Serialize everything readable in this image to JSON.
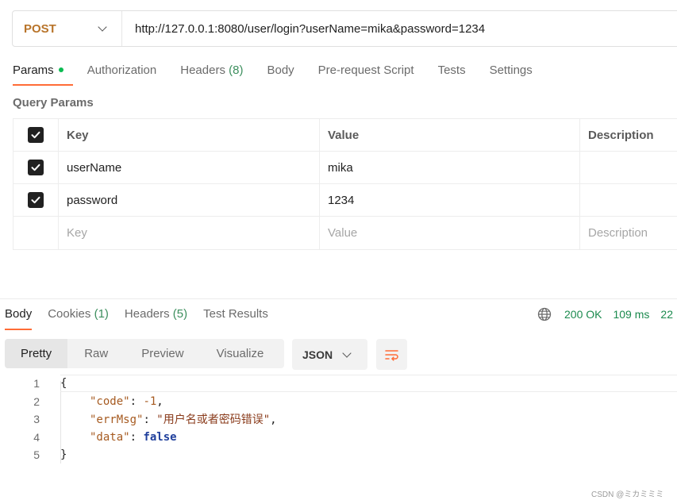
{
  "request": {
    "method": "POST",
    "url": "http://127.0.0.1:8080/user/login?userName=mika&password=1234",
    "tabs": [
      {
        "label": "Params",
        "active": true
      },
      {
        "label": "Authorization"
      },
      {
        "label": "Headers",
        "count": "(8)"
      },
      {
        "label": "Body"
      },
      {
        "label": "Pre-request Script"
      },
      {
        "label": "Tests"
      },
      {
        "label": "Settings"
      }
    ]
  },
  "query_params": {
    "title": "Query Params",
    "headers": {
      "key": "Key",
      "value": "Value",
      "description": "Description"
    },
    "rows": [
      {
        "checked": true,
        "key": "userName",
        "value": "mika",
        "description": ""
      },
      {
        "checked": true,
        "key": "password",
        "value": "1234",
        "description": ""
      }
    ],
    "placeholders": {
      "key": "Key",
      "value": "Value",
      "description": "Description"
    }
  },
  "response": {
    "tabs": [
      {
        "label": "Body",
        "active": true
      },
      {
        "label": "Cookies",
        "count": "(1)"
      },
      {
        "label": "Headers",
        "count": "(5)"
      },
      {
        "label": "Test Results"
      }
    ],
    "status": "200 OK",
    "time": "109 ms",
    "size": "22",
    "views": [
      "Pretty",
      "Raw",
      "Preview",
      "Visualize"
    ],
    "format": "JSON",
    "code_lines": [
      {
        "n": "1",
        "text": "{"
      },
      {
        "n": "2",
        "key": "\"code\"",
        "value": "-1",
        "trail": ","
      },
      {
        "n": "3",
        "key": "\"errMsg\"",
        "value": "\"用户名或者密码错误\"",
        "trail": ","
      },
      {
        "n": "4",
        "key": "\"data\"",
        "value": "false",
        "trail": ""
      },
      {
        "n": "5",
        "text": "}"
      }
    ]
  },
  "watermark": "CSDN @ミカミミミ",
  "colors": {
    "accent": "#ff6c37",
    "method": "#b8742a",
    "success": "#1b8a4e"
  }
}
